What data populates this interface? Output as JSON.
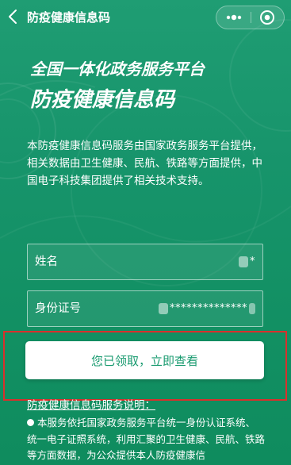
{
  "navbar": {
    "title": "防疫健康信息码",
    "back_icon": "chevron-left-icon",
    "more_icon": "more-dots-icon",
    "close_icon": "target-close-icon"
  },
  "header": {
    "subtitle": "全国一体化政务服务平台",
    "title": "防疫健康信息码"
  },
  "description": "本防疫健康信息码服务由国家政务服务平台提供，相关数据由卫生健康、民航、铁路等方面提供，中国电子科技集团提供了相关技术支持。",
  "form": {
    "name": {
      "label": "姓名",
      "value": "*"
    },
    "id_number": {
      "label": "身份证号",
      "value": "**************"
    }
  },
  "primary_button": {
    "label": "您已领取，立即查看"
  },
  "service": {
    "title": "防疫健康信息码服务说明：",
    "text": "本服务依托国家政务服务平台统一身份认证系统、统一电子证照系统，利用汇聚的卫生健康、民航、铁路等方面数据，为公众提供本人防疫健康信"
  },
  "colors": {
    "background": "#17946b",
    "button_text": "#1a9b70",
    "highlight_border": "#d9302c"
  }
}
